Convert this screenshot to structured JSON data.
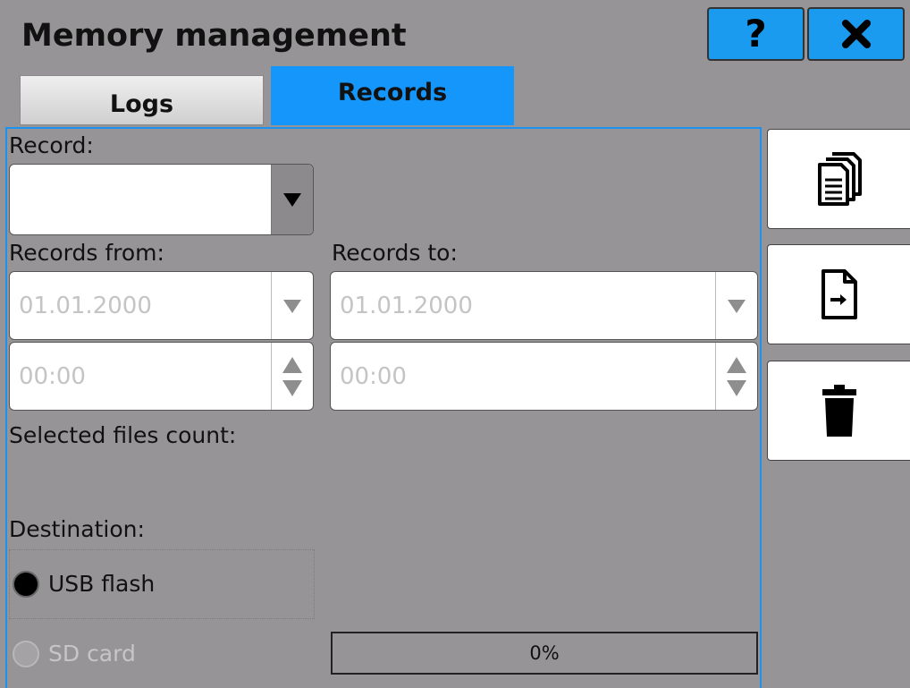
{
  "header": {
    "title": "Memory management",
    "help_label": "?",
    "close_icon": "close-icon"
  },
  "tabs": [
    {
      "label": "Logs",
      "active": false
    },
    {
      "label": "Records",
      "active": true
    }
  ],
  "form": {
    "record_label": "Record:",
    "record_value": "",
    "records_from_label": "Records from:",
    "records_to_label": "Records to:",
    "from_date": "01.01.2000",
    "from_time": "00:00",
    "to_date": "01.01.2000",
    "to_time": "00:00",
    "selected_files_label": "Selected files count:",
    "selected_files_value": "",
    "destination_label": "Destination:",
    "destinations": [
      {
        "label": "USB flash",
        "selected": true,
        "enabled": true
      },
      {
        "label": "SD card",
        "selected": false,
        "enabled": false
      }
    ]
  },
  "progress": {
    "label": "0%",
    "value": 0
  },
  "side_actions": [
    {
      "icon": "copy-icon"
    },
    {
      "icon": "export-file-icon"
    },
    {
      "icon": "trash-icon"
    }
  ],
  "colors": {
    "accent": "#1596fb",
    "background": "#969496"
  }
}
